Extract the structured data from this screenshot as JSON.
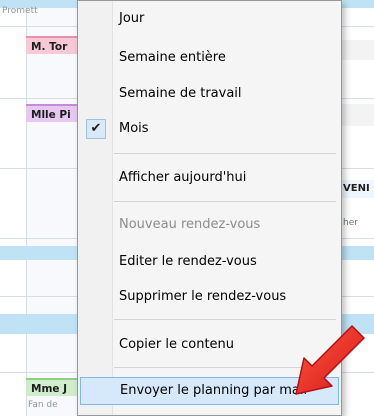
{
  "calendar": {
    "snippets": {
      "top_left": "Promett",
      "bottom_left": "Fan de",
      "right_side_text": "her"
    },
    "appointments": [
      {
        "label": "M. Tor",
        "color": "pink"
      },
      {
        "label": "Mlle Pi",
        "color": "purple"
      },
      {
        "label": "Mme J",
        "color": "green"
      }
    ],
    "right_label": "VENI"
  },
  "context_menu": {
    "items": [
      {
        "label": "Jour",
        "enabled": true,
        "checked": false
      },
      {
        "label": "Semaine entière",
        "enabled": true,
        "checked": false
      },
      {
        "label": "Semaine de travail",
        "enabled": true,
        "checked": false
      },
      {
        "label": "Mois",
        "enabled": true,
        "checked": true
      },
      {
        "label": "Afficher aujourd'hui",
        "enabled": true,
        "checked": false
      },
      {
        "label": "Nouveau rendez-vous",
        "enabled": false,
        "checked": false
      },
      {
        "label": "Editer le rendez-vous",
        "enabled": true,
        "checked": false
      },
      {
        "label": "Supprimer le rendez-vous",
        "enabled": true,
        "checked": false
      },
      {
        "label": "Copier le contenu",
        "enabled": true,
        "checked": false
      },
      {
        "label": "Envoyer le planning par mail",
        "enabled": true,
        "checked": false,
        "highlighted": true
      }
    ],
    "check_glyph": "✔"
  },
  "colors": {
    "menu_bg": "#f5f5f5",
    "hover_bg": "#d6e9fb",
    "hover_border": "#7fb7e8",
    "arrow_red": "#e8262a"
  }
}
